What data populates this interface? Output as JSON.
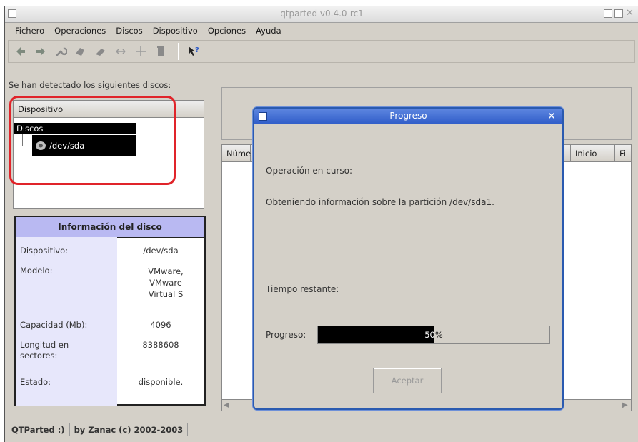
{
  "window": {
    "title": "qtparted v0.4.0-rc1"
  },
  "menubar": [
    {
      "label": "Fichero"
    },
    {
      "label": "Operaciones"
    },
    {
      "label": "Discos"
    },
    {
      "label": "Dispositivo"
    },
    {
      "label": "Opciones"
    },
    {
      "label": "Ayuda"
    }
  ],
  "toolbar": {
    "icons": [
      "undo-icon",
      "redo-icon",
      "wrench-icon",
      "format-icon",
      "eraser-icon",
      "resize-icon",
      "move-icon",
      "delete-icon",
      "whats-this-icon"
    ]
  },
  "left": {
    "detected_label": "Se han detectado los siguientes discos:",
    "tree_header": "Dispositivo",
    "tree_group": "Discos",
    "tree_item": "/dev/sda"
  },
  "disk_info": {
    "title": "Información del disco",
    "rows": [
      {
        "label": "Dispositivo:",
        "value": "/dev/sda"
      },
      {
        "label": "Modelo:",
        "value": "VMware, VMware Virtual S"
      },
      {
        "label": "Capacidad (Mb):",
        "value": "4096"
      },
      {
        "label": "Longitud en sectores:",
        "value": "8388608"
      },
      {
        "label": "Estado:",
        "value": "disponible."
      }
    ]
  },
  "partitions": {
    "headers": [
      "Núme",
      "Inicio",
      "Fi"
    ]
  },
  "statusbar": {
    "app": "QTParted :)",
    "author": "by Zanac (c) 2002-2003"
  },
  "dialog": {
    "title": "Progreso",
    "operation_label": "Operación en curso:",
    "operation_text": "Obteniendo información sobre la partición /dev/sda1.",
    "remaining_label": "Tiempo restante:",
    "progress_label": "Progreso:",
    "progress_percent": 50,
    "progress_text_a": "50",
    "progress_text_b": "%",
    "accept_label": "Aceptar"
  },
  "colors": {
    "accent": "#2f5cc8",
    "highlight": "#e0242a",
    "info_header": "#b9b9f2"
  }
}
